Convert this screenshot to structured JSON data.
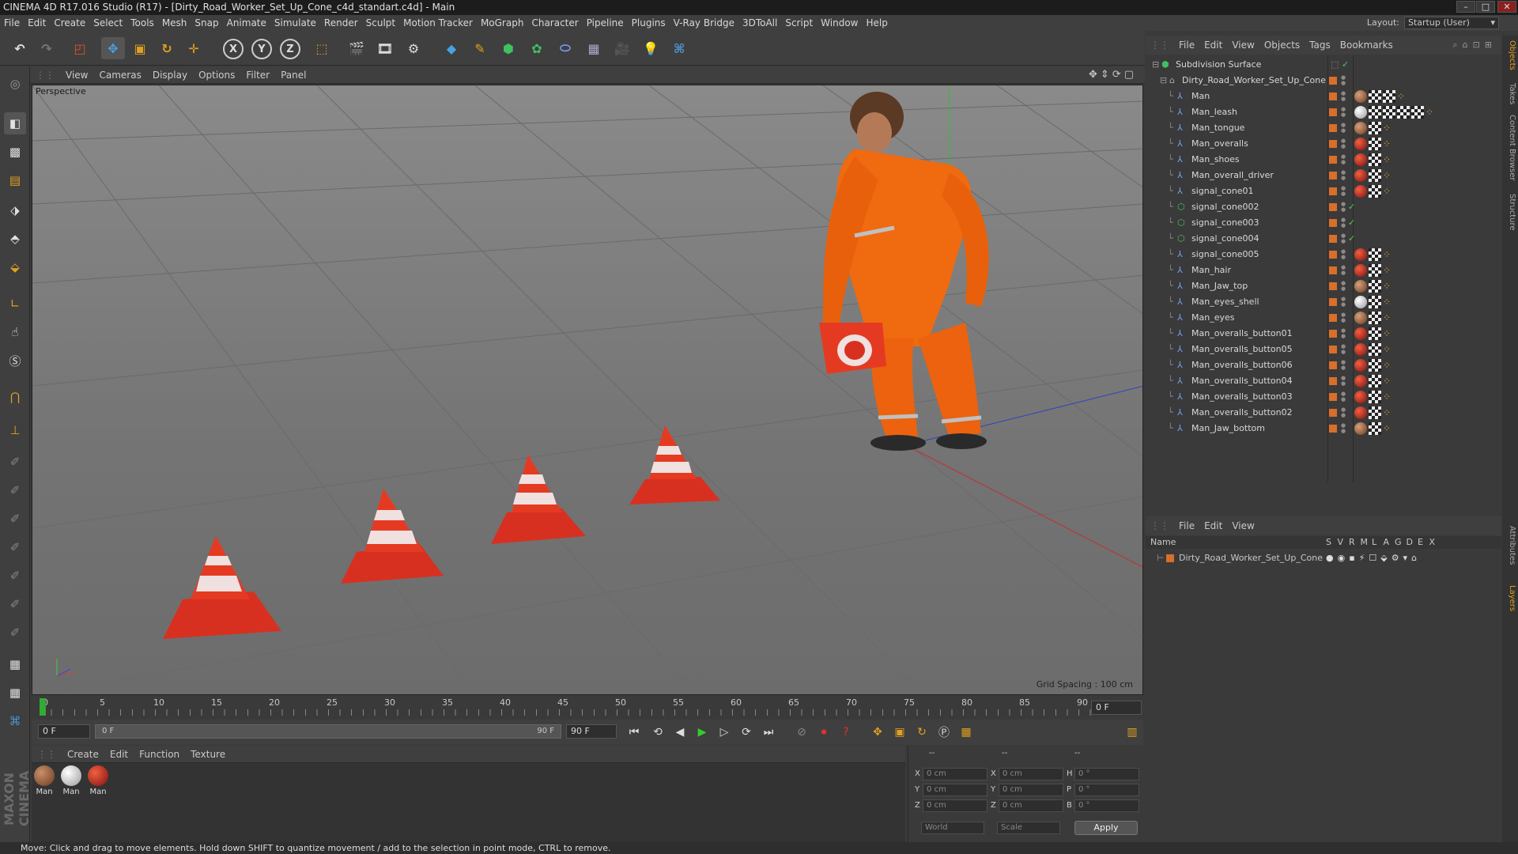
{
  "window": {
    "title": "CINEMA 4D R17.016 Studio (R17) - [Dirty_Road_Worker_Set_Up_Cone_c4d_standart.c4d] - Main",
    "layout_label": "Layout:",
    "layout_value": "Startup (User)"
  },
  "menu": [
    "File",
    "Edit",
    "Create",
    "Select",
    "Tools",
    "Mesh",
    "Snap",
    "Animate",
    "Simulate",
    "Render",
    "Sculpt",
    "Motion Tracker",
    "MoGraph",
    "Character",
    "Pipeline",
    "Plugins",
    "V-Ray Bridge",
    "3DToAll",
    "Script",
    "Window",
    "Help"
  ],
  "toolbar": {
    "x_label": "X",
    "y_label": "Y",
    "z_label": "Z"
  },
  "viewport": {
    "menu": [
      "View",
      "Cameras",
      "Display",
      "Options",
      "Filter",
      "Panel"
    ],
    "label": "Perspective",
    "grid_spacing": "Grid Spacing : 100 cm"
  },
  "timeline": {
    "ticks": [
      "0",
      "5",
      "10",
      "15",
      "20",
      "25",
      "30",
      "35",
      "40",
      "45",
      "50",
      "55",
      "60",
      "65",
      "70",
      "75",
      "80",
      "85",
      "90"
    ],
    "end_field": "0 F",
    "current_frame": "0 F",
    "range_start": "0 F",
    "range_end": "90 F",
    "max_frame": "90 F"
  },
  "materials": {
    "menu": [
      "Create",
      "Edit",
      "Function",
      "Texture"
    ],
    "items": [
      {
        "label": "Man",
        "color": "#8a5a3a"
      },
      {
        "label": "Man",
        "color": "#c8c8c8"
      },
      {
        "label": "Man",
        "color": "#c0301a"
      }
    ]
  },
  "coords": {
    "header": [
      "--",
      "--",
      "--"
    ],
    "rows": [
      {
        "a": "X",
        "av": "0 cm",
        "b": "X",
        "bv": "0 cm",
        "c": "H",
        "cv": "0 °"
      },
      {
        "a": "Y",
        "av": "0 cm",
        "b": "Y",
        "bv": "0 cm",
        "c": "P",
        "cv": "0 °"
      },
      {
        "a": "Z",
        "av": "0 cm",
        "b": "Z",
        "bv": "0 cm",
        "c": "B",
        "cv": "0 °"
      }
    ],
    "world": "World",
    "scale": "Scale",
    "apply": "Apply"
  },
  "status": "Move: Click and drag to move elements. Hold down SHIFT to quantize movement / add to the selection in point mode, CTRL to remove.",
  "logo": "MAXON CINEMA 4D",
  "object_manager": {
    "menu": [
      "File",
      "Edit",
      "View",
      "Objects",
      "Tags",
      "Bookmarks"
    ],
    "root": "Subdivision Surface",
    "group": "Dirty_Road_Worker_Set_Up_Cone",
    "objects": [
      {
        "name": "Man",
        "tags": "bcc"
      },
      {
        "name": "Man_leash",
        "tags": "wcccc"
      },
      {
        "name": "Man_tongue",
        "tags": "bc"
      },
      {
        "name": "Man_overalls",
        "tags": "rc"
      },
      {
        "name": "Man_shoes",
        "tags": "rc"
      },
      {
        "name": "Man_overall_driver",
        "tags": "rc"
      },
      {
        "name": "signal_cone01",
        "tags": "rc"
      },
      {
        "name": "signal_cone002",
        "tags": ""
      },
      {
        "name": "signal_cone003",
        "tags": ""
      },
      {
        "name": "signal_cone004",
        "tags": ""
      },
      {
        "name": "signal_cone005",
        "tags": "rc"
      },
      {
        "name": "Man_hair",
        "tags": "rc"
      },
      {
        "name": "Man_Jaw_top",
        "tags": "bc"
      },
      {
        "name": "Man_eyes_shell",
        "tags": "wc"
      },
      {
        "name": "Man_eyes",
        "tags": "bc"
      },
      {
        "name": "Man_overalls_button01",
        "tags": "rc"
      },
      {
        "name": "Man_overalls_button05",
        "tags": "rc"
      },
      {
        "name": "Man_overalls_button06",
        "tags": "rc"
      },
      {
        "name": "Man_overalls_button04",
        "tags": "rc"
      },
      {
        "name": "Man_overalls_button03",
        "tags": "rc"
      },
      {
        "name": "Man_overalls_button02",
        "tags": "rc"
      },
      {
        "name": "Man_Jaw_bottom",
        "tags": "bc"
      }
    ]
  },
  "layer_manager": {
    "menu": [
      "File",
      "Edit",
      "View"
    ],
    "name_header": "Name",
    "cols": [
      "S",
      "V",
      "R",
      "M",
      "L",
      "A",
      "G",
      "D",
      "E",
      "X"
    ],
    "layer": "Dirty_Road_Worker_Set_Up_Cone"
  },
  "side_tabs": [
    "Objects",
    "Takes",
    "Content Browser",
    "Structure",
    "Attributes",
    "Layers"
  ]
}
